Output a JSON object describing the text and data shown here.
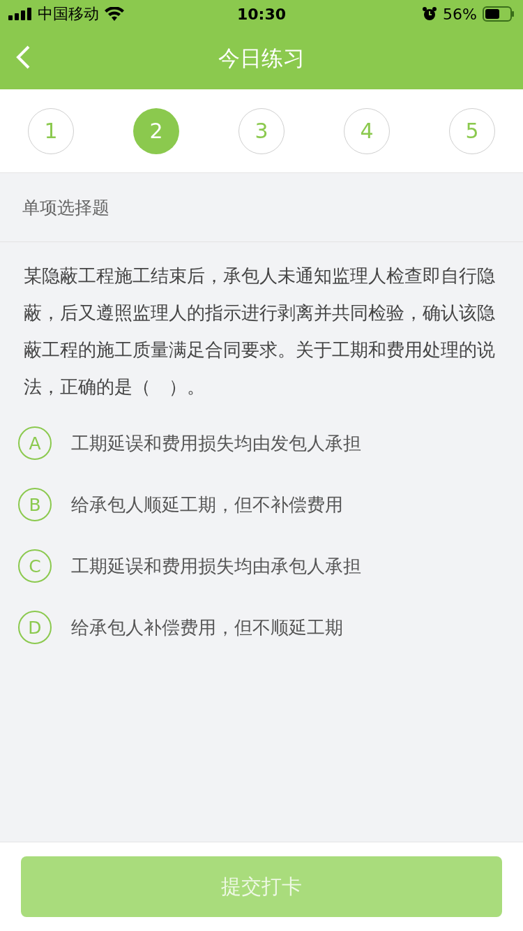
{
  "status_bar": {
    "carrier": "中国移动",
    "time": "10:30",
    "battery": "56%"
  },
  "nav": {
    "title": "今日练习"
  },
  "steps": [
    {
      "label": "1",
      "selected": false
    },
    {
      "label": "2",
      "selected": true
    },
    {
      "label": "3",
      "selected": false
    },
    {
      "label": "4",
      "selected": false
    },
    {
      "label": "5",
      "selected": false
    }
  ],
  "question_type": "单项选择题",
  "question": "某隐蔽工程施工结束后，承包人未通知监理人检查即自行隐蔽，后又遵照监理人的指示进行剥离并共同检验，确认该隐蔽工程的施工质量满足合同要求。关于工期和费用处理的说法，正确的是（　）。",
  "options": [
    {
      "letter": "A",
      "text": "工期延误和费用损失均由发包人承担",
      "selected": false
    },
    {
      "letter": "B",
      "text": "给承包人顺延工期，但不补偿费用",
      "selected": false
    },
    {
      "letter": "C",
      "text": "工期延误和费用损失均由承包人承担",
      "selected": false
    },
    {
      "letter": "D",
      "text": "给承包人补偿费用，但不顺延工期",
      "selected": false
    }
  ],
  "submit": {
    "label": "提交打卡",
    "disabled": true
  }
}
